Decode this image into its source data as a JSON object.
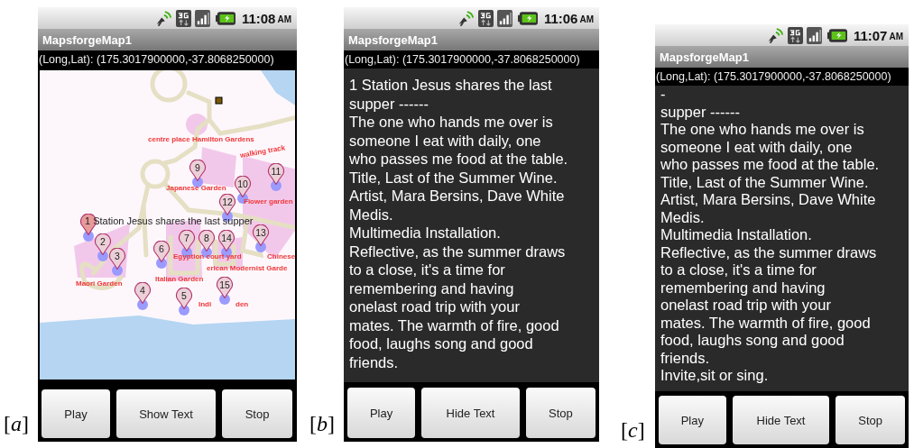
{
  "panels": [
    {
      "tag": "[*a*]",
      "kind": "map",
      "status": {
        "time": "11:08",
        "ampm": "AM"
      },
      "title": "MapsforgeMap1",
      "coordinates": "(Long,Lat): (175.3017900000,-37.8068250000)",
      "map": {
        "labels": [
          "centre place Hamilton Gardens",
          "walking track",
          "Japanese Garden",
          "Flower garden",
          "Egyption court yard",
          "Chinese",
          "erican Modernist Garde",
          "Italian Garden",
          "Maori Garden",
          "Indi",
          "den"
        ],
        "pins": [
          {
            "selected": true
          },
          {
            "label": "2",
            "selected": false
          },
          {
            "label": "3",
            "selected": false
          },
          {
            "label": "4",
            "selected": false
          },
          {
            "label": "5",
            "selected": false
          },
          {
            "label": "6",
            "selected": false
          },
          {
            "label": "7",
            "selected": false
          },
          {
            "label": "8",
            "selected": false
          },
          {
            "label": "9",
            "selected": false
          },
          {
            "label": "10",
            "selected": false
          },
          {
            "label": "11",
            "selected": false
          },
          {
            "label": "12",
            "selected": false
          },
          {
            "label": "13",
            "selected": false
          },
          {
            "label": "14",
            "selected": false
          },
          {
            "label": "15",
            "selected": false
          }
        ],
        "callout": "1 Station Jesus shares the last supper"
      },
      "buttons": [
        "Play",
        "Show Text",
        "Stop"
      ]
    },
    {
      "tag": "[*b*]",
      "kind": "text",
      "status": {
        "time": "11:06",
        "ampm": "AM"
      },
      "title": "MapsforgeMap1",
      "coordinates": "(Long,Lat): (175.3017900000,-37.8068250000)",
      "text_lines": [
        "1 Station Jesus shares the last",
        "supper ------",
        "The one who hands me over is",
        "someone I eat with daily, one",
        "who passes me food at the table.",
        "Title, Last of the Summer Wine.",
        "Artist, Mara Bersins, Dave White",
        "Medis.",
        "Multimedia Installation.",
        "Reflective, as the summer draws",
        "to a close, it's a time for",
        "remembering and having",
        "onelast road trip with your",
        "mates. The warmth of fire, good",
        "food, laughs song and good",
        "friends."
      ],
      "buttons": [
        "Play",
        "Hide Text",
        "Stop"
      ]
    },
    {
      "tag": "[*c*]",
      "kind": "text",
      "status": {
        "time": "11:07",
        "ampm": "AM"
      },
      "title": "MapsforgeMap1",
      "coordinates": "(Long,Lat): (175.3017900000,-37.8068250000)",
      "text_lines": [
        "-",
        "supper ------",
        "The one who hands me over is",
        "someone I eat with daily, one",
        "who passes me food at the table.",
        "Title, Last of the Summer Wine.",
        "Artist, Mara Bersins, Dave White",
        "Medis.",
        "Multimedia Installation.",
        "Reflective, as the summer draws",
        "to a close, it's a time for",
        "remembering and having",
        "onelast road trip with your",
        "mates. The warmth of fire, good",
        "food, laughs song and good",
        "friends.",
        "Invite,sit or sing."
      ],
      "buttons": [
        "Play",
        "Hide Text",
        "Stop"
      ]
    }
  ]
}
